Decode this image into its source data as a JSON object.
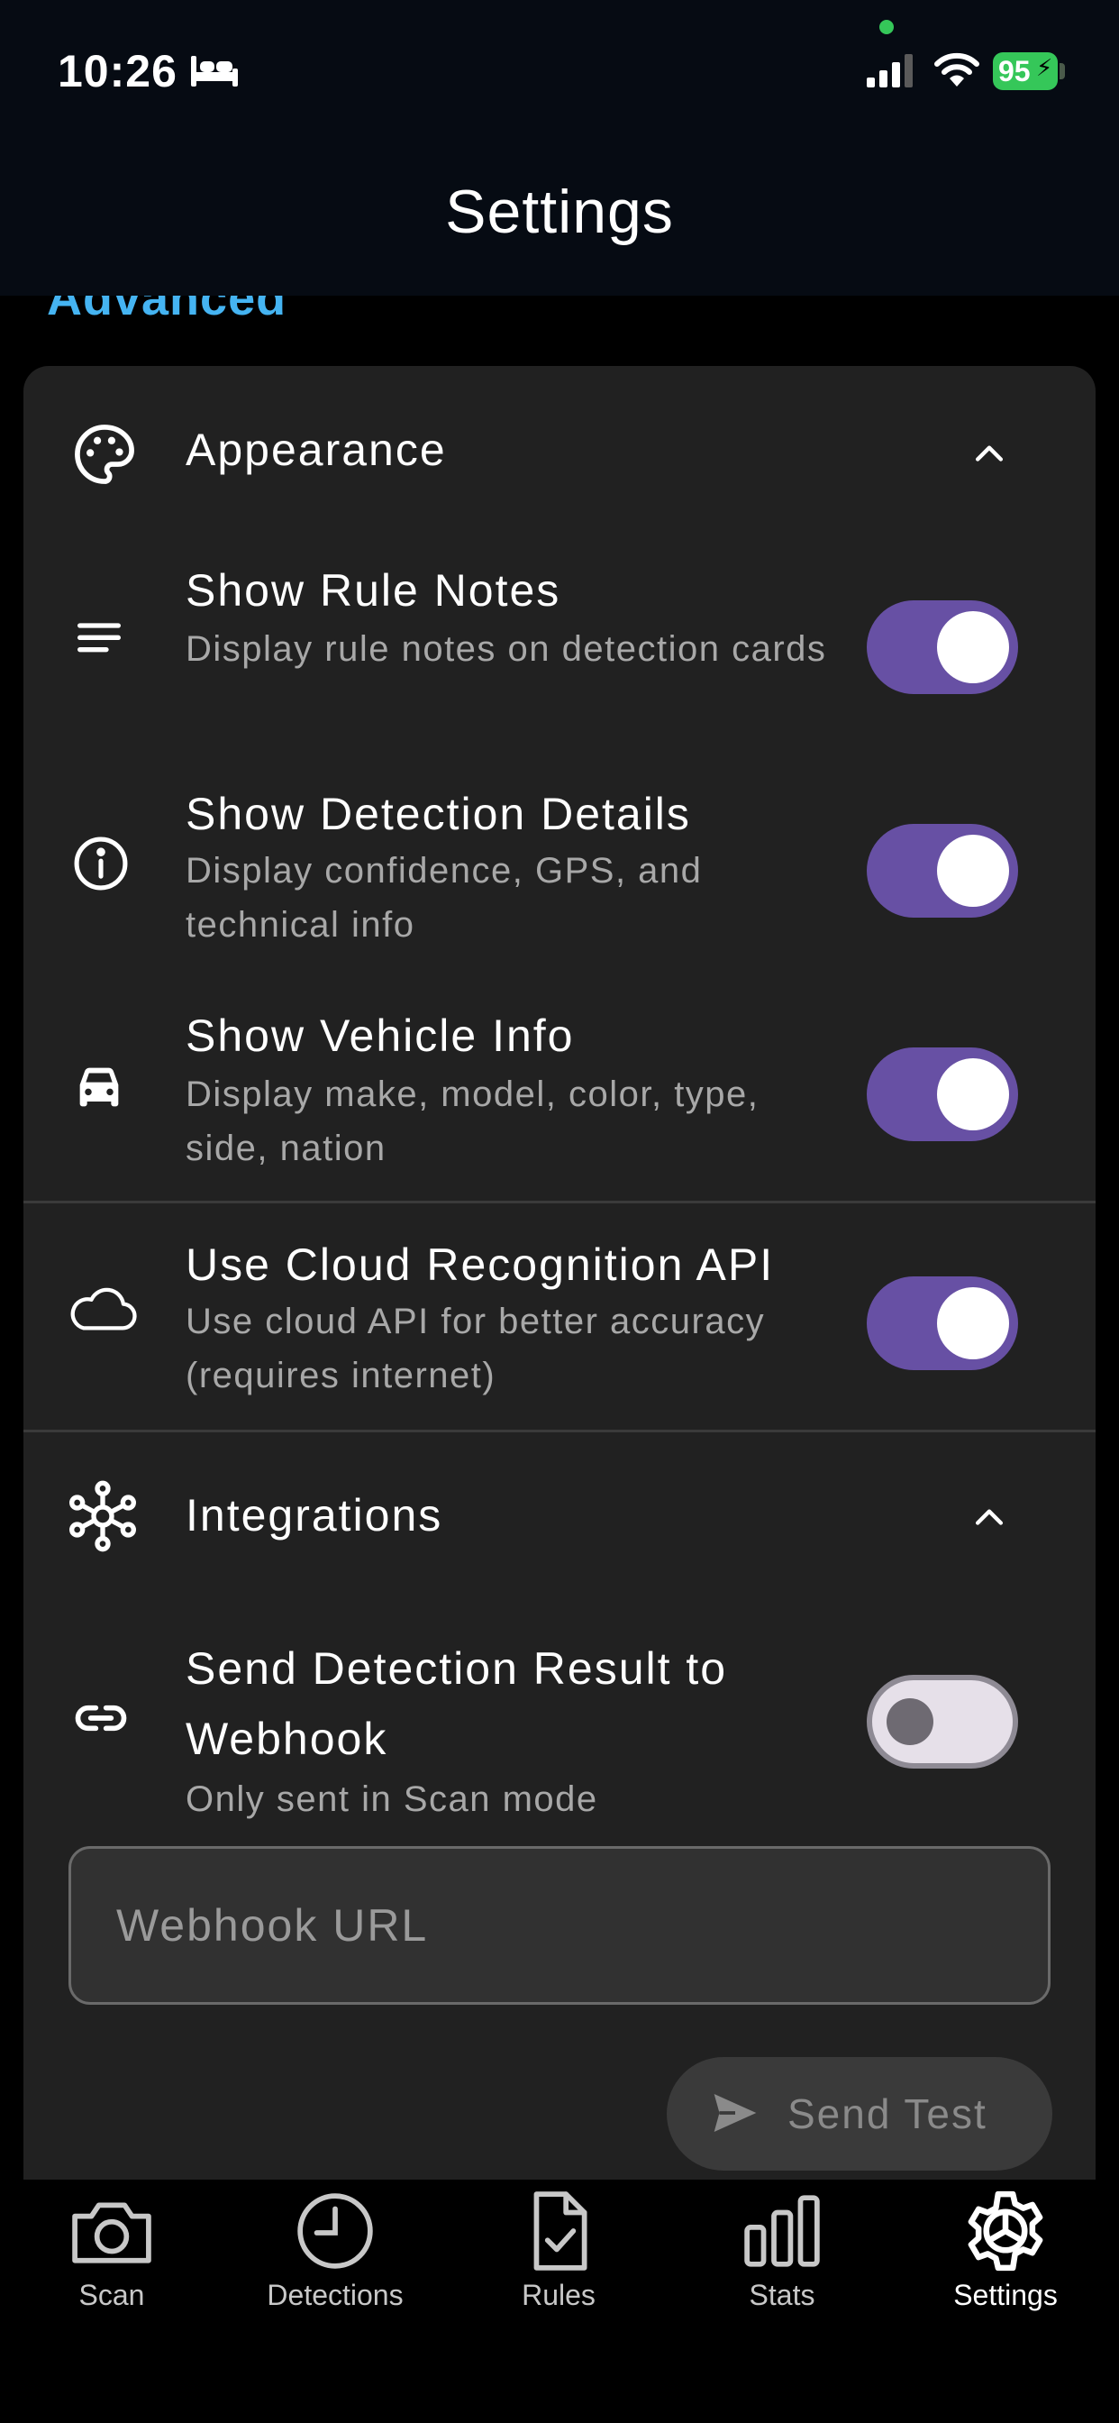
{
  "status_bar": {
    "time": "10:26",
    "battery": "95"
  },
  "header": {
    "title": "Settings"
  },
  "section": {
    "label": "Advanced"
  },
  "appearance": {
    "title": "Appearance",
    "icon": "palette-icon",
    "expanded": true,
    "items": [
      {
        "title": "Show Rule Notes",
        "desc": "Display rule notes on detection cards",
        "icon": "notes-lines-icon",
        "enabled": true
      },
      {
        "title": "Show Detection Details",
        "desc": "Display confidence, GPS, and technical info",
        "icon": "info-icon",
        "enabled": true
      },
      {
        "title": "Show Vehicle Info",
        "desc": "Display make, model, color, type, side, nation",
        "icon": "car-icon",
        "enabled": true
      }
    ]
  },
  "cloud": {
    "title": "Use Cloud Recognition API",
    "desc": "Use cloud API for better accuracy (requires internet)",
    "icon": "cloud-icon",
    "enabled": true
  },
  "integrations": {
    "title": "Integrations",
    "icon": "hub-icon",
    "expanded": true,
    "webhook": {
      "title": "Send Detection Result to Webhook",
      "desc": "Only sent in Scan mode",
      "icon": "link-icon",
      "enabled": false,
      "url_value": "",
      "url_placeholder": "Webhook URL",
      "send_test_label": "Send Test"
    }
  },
  "colors": {
    "accent": "#6750a4",
    "section_label": "#45b4f2",
    "card": "#212121"
  },
  "nav": {
    "items": [
      {
        "label": "Scan",
        "icon": "camera-icon",
        "active": false
      },
      {
        "label": "Detections",
        "icon": "clock-icon",
        "active": false
      },
      {
        "label": "Rules",
        "icon": "document-check-icon",
        "active": false
      },
      {
        "label": "Stats",
        "icon": "bar-chart-icon",
        "active": false
      },
      {
        "label": "Settings",
        "icon": "gear-icon",
        "active": true
      }
    ]
  }
}
